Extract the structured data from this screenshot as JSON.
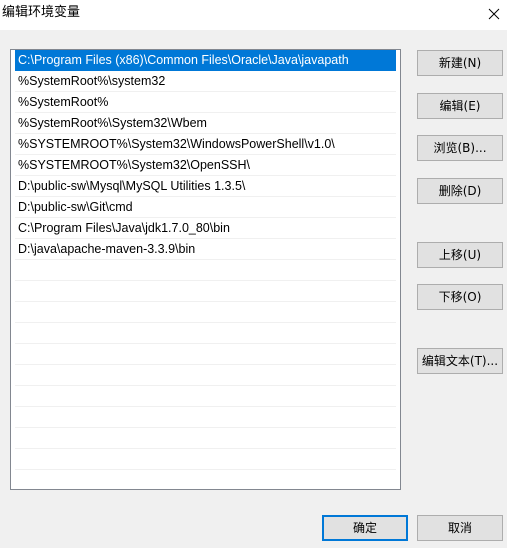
{
  "window": {
    "title": "编辑环境变量",
    "close_icon": "close-icon"
  },
  "list": {
    "selected_index": 0,
    "items": [
      "C:\\Program Files (x86)\\Common Files\\Oracle\\Java\\javapath",
      "%SystemRoot%\\system32",
      "%SystemRoot%",
      "%SystemRoot%\\System32\\Wbem",
      "%SYSTEMROOT%\\System32\\WindowsPowerShell\\v1.0\\",
      "%SYSTEMROOT%\\System32\\OpenSSH\\",
      "D:\\public-sw\\Mysql\\MySQL Utilities 1.3.5\\",
      "D:\\public-sw\\Git\\cmd",
      "C:\\Program Files\\Java\\jdk1.7.0_80\\bin",
      "D:\\java\\apache-maven-3.3.9\\bin",
      "",
      "",
      "",
      "",
      "",
      "",
      "",
      "",
      "",
      "",
      ""
    ]
  },
  "buttons": {
    "new": "新建(N)",
    "edit": "编辑(E)",
    "browse": "浏览(B)...",
    "delete": "删除(D)",
    "move_up": "上移(U)",
    "move_down": "下移(O)",
    "edit_text": "编辑文本(T)...",
    "ok": "确定",
    "cancel": "取消"
  },
  "colors": {
    "selection": "#0078d7",
    "dialog_bg": "#f0f0f0",
    "button_bg": "#e1e1e1",
    "button_border": "#adadad"
  }
}
